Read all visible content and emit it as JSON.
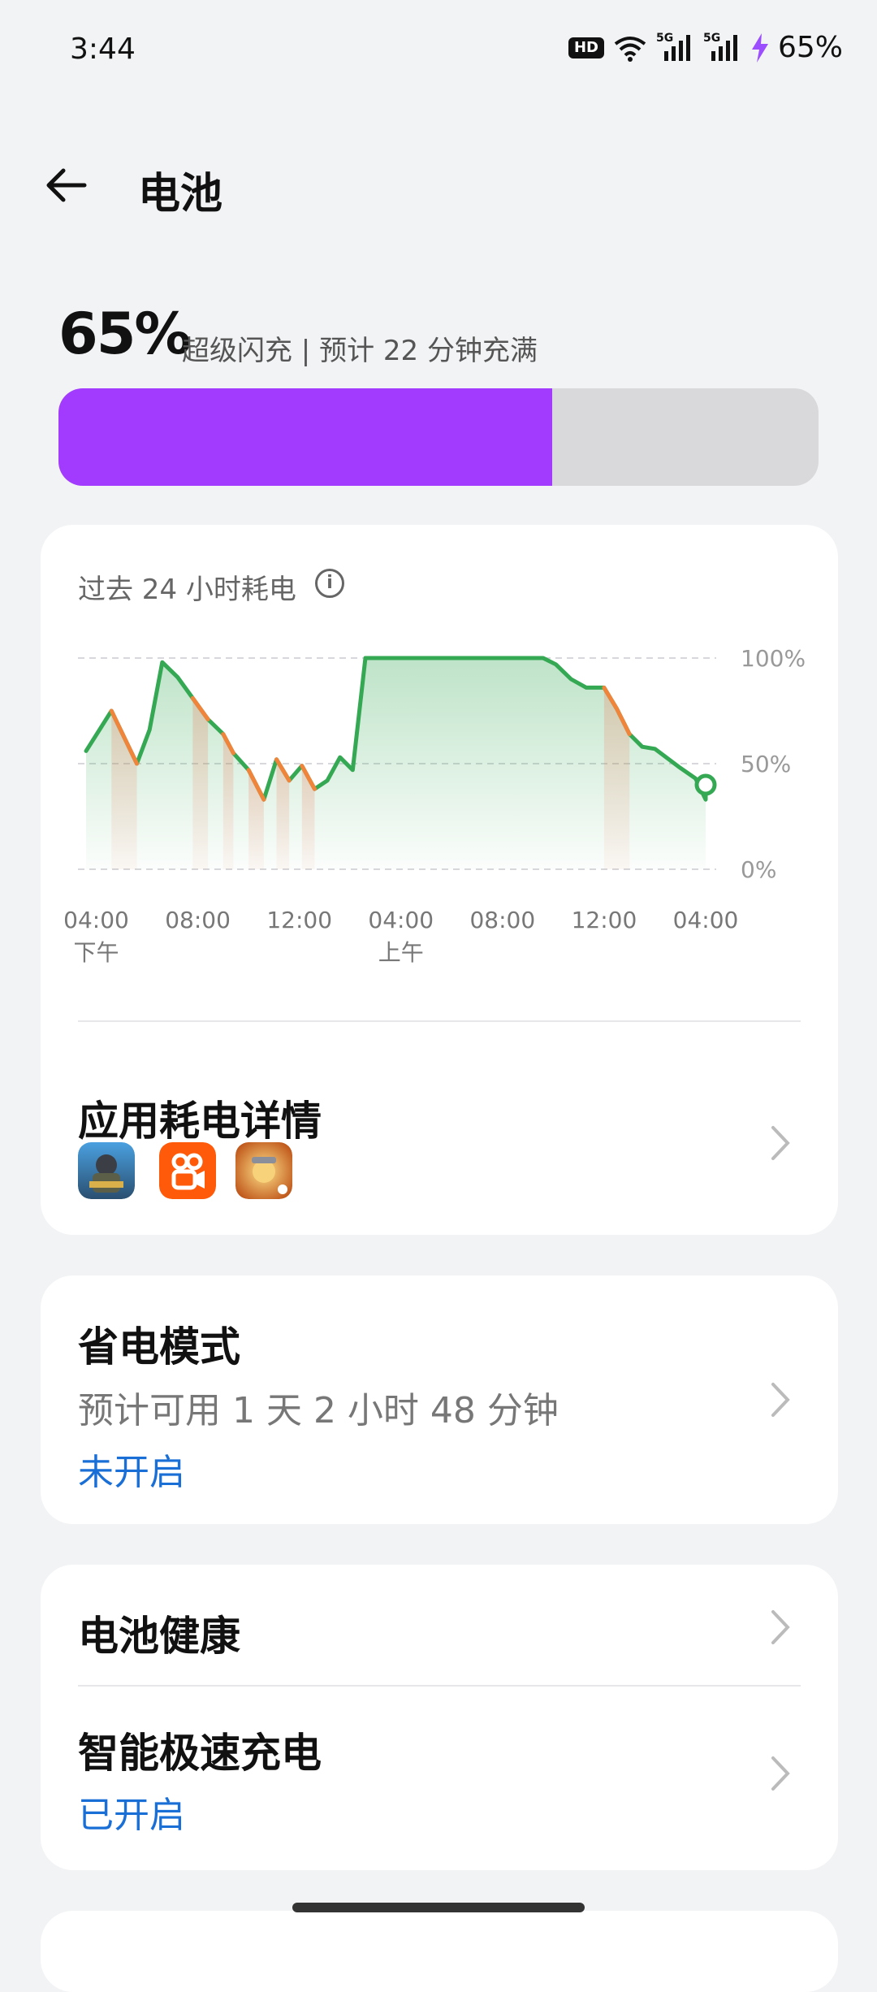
{
  "status_bar": {
    "time": "3:44",
    "hd_badge": "HD",
    "network_1": "5G",
    "network_2": "5G",
    "battery": "65%",
    "icons": [
      "hd-voice-icon",
      "wifi-icon",
      "signal-icon",
      "signal-icon",
      "charging-bolt-icon"
    ]
  },
  "header": {
    "title": "电池",
    "back_icon": "back-arrow-icon"
  },
  "battery": {
    "percent_label": "65%",
    "level": 0.65,
    "charge_status": "超级闪充 | 预计 22 分钟充满",
    "fill_color": "#a33bff",
    "track_color": "#d9d9db"
  },
  "usage_card": {
    "title": "过去 24 小时耗电",
    "info_icon": "info-icon",
    "chart_data": {
      "type": "line",
      "title": "过去 24 小时耗电",
      "y_tick_labels": [
        "100%",
        "50%",
        "0%"
      ],
      "ylim": [
        0,
        100
      ],
      "grid": true,
      "x_ticks": [
        {
          "t": 0,
          "label": "04:00",
          "sub": "下午"
        },
        {
          "t": 4,
          "label": "08:00",
          "sub": ""
        },
        {
          "t": 8,
          "label": "12:00",
          "sub": ""
        },
        {
          "t": 12,
          "label": "04:00",
          "sub": "上午"
        },
        {
          "t": 16,
          "label": "08:00",
          "sub": ""
        },
        {
          "t": 20,
          "label": "12:00",
          "sub": ""
        },
        {
          "t": 24,
          "label": "04:00",
          "sub": ""
        }
      ],
      "xlim": [
        -0.4,
        24
      ],
      "line_color": "#34a853",
      "discharge_color": "#f0843a",
      "series": [
        {
          "values": [
            [
              -0.4,
              56
            ],
            [
              0.6,
              75
            ],
            [
              1.6,
              50
            ],
            [
              2.1,
              66
            ],
            [
              2.6,
              98
            ],
            [
              3.2,
              91
            ],
            [
              3.8,
              81
            ],
            [
              4.4,
              71
            ],
            [
              5.0,
              64
            ],
            [
              5.4,
              55
            ],
            [
              6.0,
              47
            ],
            [
              6.6,
              33
            ],
            [
              7.1,
              52
            ],
            [
              7.6,
              42
            ],
            [
              8.1,
              49
            ],
            [
              8.6,
              38
            ],
            [
              9.1,
              42
            ],
            [
              9.6,
              53
            ],
            [
              10.1,
              47
            ],
            [
              10.6,
              100
            ],
            [
              17.6,
              100
            ],
            [
              18.1,
              97
            ],
            [
              18.7,
              90
            ],
            [
              19.3,
              86
            ],
            [
              20.0,
              86
            ],
            [
              20.5,
              76
            ],
            [
              21.0,
              64
            ],
            [
              21.5,
              58
            ],
            [
              22.0,
              57
            ],
            [
              23.0,
              48
            ],
            [
              23.6,
              43
            ],
            [
              24.0,
              33
            ],
            [
              24.0,
              40
            ]
          ]
        }
      ],
      "discharge_ranges": [
        [
          0.6,
          1.6
        ],
        [
          3.8,
          4.4
        ],
        [
          5.0,
          5.4
        ],
        [
          6.0,
          6.6
        ],
        [
          7.1,
          7.6
        ],
        [
          8.1,
          8.6
        ],
        [
          20.0,
          21.0
        ]
      ],
      "current_marker": [
        24.0,
        40
      ]
    }
  },
  "app_usage": {
    "title": "应用耗电详情",
    "apps": [
      {
        "icon": "pubg-app-icon"
      },
      {
        "icon": "kuaishou-app-icon"
      },
      {
        "icon": "naruto-app-icon"
      }
    ]
  },
  "power_saving": {
    "title": "省电模式",
    "estimate": "预计可用 1 天 2 小时 48 分钟",
    "status": "未开启"
  },
  "battery_health": {
    "title": "电池健康"
  },
  "smart_charge": {
    "title": "智能极速充电",
    "status": "已开启"
  },
  "colors": {
    "accent_blue": "#1a6fd6",
    "background": "#f2f3f5"
  }
}
